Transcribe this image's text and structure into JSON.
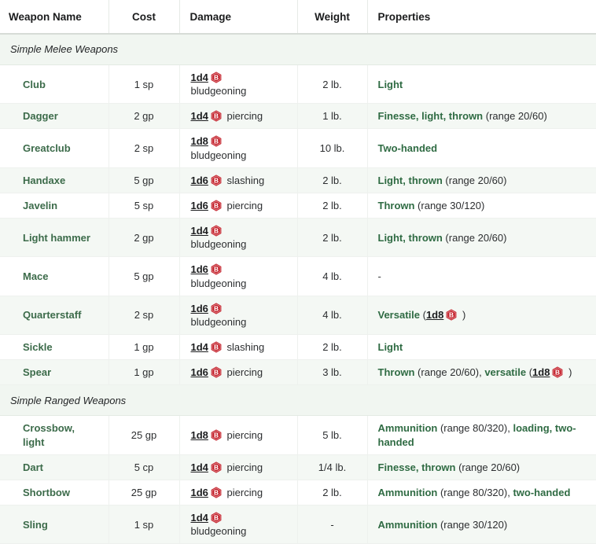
{
  "table": {
    "columns": [
      {
        "key": "name",
        "label": "Weapon Name"
      },
      {
        "key": "cost",
        "label": "Cost"
      },
      {
        "key": "damage",
        "label": "Damage"
      },
      {
        "key": "weight",
        "label": "Weight"
      },
      {
        "key": "props",
        "label": "Properties"
      }
    ],
    "icons": {
      "roll_badge": "beyond20-roll-badge-icon",
      "roll_badge_letter": "B",
      "roll_badge_color": "#c4202a"
    },
    "colors": {
      "weapon_link": "#3c6b4a",
      "property_link": "#2f6b43",
      "dice_link": "#1c1d1f",
      "row_alt_background": "#f4f8f4",
      "section_background": "#f1f6f1",
      "header_border": "#d7dcd7"
    },
    "sections": [
      {
        "title": "Simple Melee Weapons",
        "rows": [
          {
            "name": "Club",
            "cost": "1 sp",
            "damage_dice": "1d4",
            "damage_type": "bludgeoning",
            "damage_wrap": true,
            "weight": "2 lb.",
            "properties": [
              {
                "text": "Light",
                "link": true
              }
            ]
          },
          {
            "name": "Dagger",
            "cost": "2 gp",
            "damage_dice": "1d4",
            "damage_type": "piercing",
            "damage_wrap": false,
            "weight": "1 lb.",
            "properties": [
              {
                "text": "Finesse, light, thrown",
                "link": true
              },
              {
                "text": " (range 20/60)",
                "link": false
              }
            ]
          },
          {
            "name": "Greatclub",
            "cost": "2 sp",
            "damage_dice": "1d8",
            "damage_type": "bludgeoning",
            "damage_wrap": true,
            "weight": "10 lb.",
            "properties": [
              {
                "text": "Two-handed",
                "link": true
              }
            ]
          },
          {
            "name": "Handaxe",
            "cost": "5 gp",
            "damage_dice": "1d6",
            "damage_type": "slashing",
            "damage_wrap": false,
            "weight": "2 lb.",
            "properties": [
              {
                "text": "Light, thrown",
                "link": true
              },
              {
                "text": " (range 20/60)",
                "link": false
              }
            ]
          },
          {
            "name": "Javelin",
            "cost": "5 sp",
            "damage_dice": "1d6",
            "damage_type": "piercing",
            "damage_wrap": false,
            "weight": "2 lb.",
            "properties": [
              {
                "text": "Thrown",
                "link": true
              },
              {
                "text": " (range 30/120)",
                "link": false
              }
            ]
          },
          {
            "name": "Light hammer",
            "cost": "2 gp",
            "damage_dice": "1d4",
            "damage_type": "bludgeoning",
            "damage_wrap": true,
            "weight": "2 lb.",
            "properties": [
              {
                "text": "Light, thrown",
                "link": true
              },
              {
                "text": " (range 20/60)",
                "link": false
              }
            ]
          },
          {
            "name": "Mace",
            "cost": "5 gp",
            "damage_dice": "1d6",
            "damage_type": "bludgeoning",
            "damage_wrap": true,
            "weight": "4 lb.",
            "properties": [
              {
                "text": "-",
                "link": false
              }
            ]
          },
          {
            "name": "Quarterstaff",
            "cost": "2 sp",
            "damage_dice": "1d6",
            "damage_type": "bludgeoning",
            "damage_wrap": true,
            "weight": "4 lb.",
            "properties": [
              {
                "text": "Versatile",
                "link": true
              },
              {
                "text": " (",
                "link": false
              },
              {
                "text": "1d8",
                "dice": true
              },
              {
                "text": " )",
                "link": false
              }
            ]
          },
          {
            "name": "Sickle",
            "cost": "1 gp",
            "damage_dice": "1d4",
            "damage_type": "slashing",
            "damage_wrap": false,
            "weight": "2 lb.",
            "properties": [
              {
                "text": "Light",
                "link": true
              }
            ]
          },
          {
            "name": "Spear",
            "cost": "1 gp",
            "damage_dice": "1d6",
            "damage_type": "piercing",
            "damage_wrap": false,
            "weight": "3 lb.",
            "properties": [
              {
                "text": "Thrown",
                "link": true
              },
              {
                "text": " (range 20/60), ",
                "link": false
              },
              {
                "text": "versatile",
                "link": true
              },
              {
                "text": " (",
                "link": false
              },
              {
                "text": "1d8",
                "dice": true
              },
              {
                "text": " )",
                "link": false
              }
            ]
          }
        ]
      },
      {
        "title": "Simple Ranged Weapons",
        "rows": [
          {
            "name": "Crossbow,\nlight",
            "cost": "25 gp",
            "damage_dice": "1d8",
            "damage_type": "piercing",
            "damage_wrap": false,
            "weight": "5 lb.",
            "properties": [
              {
                "text": "Ammunition",
                "link": true
              },
              {
                "text": " (range 80/320), ",
                "link": false
              },
              {
                "text": "loading, two-handed",
                "link": true
              }
            ]
          },
          {
            "name": "Dart",
            "cost": "5 cp",
            "damage_dice": "1d4",
            "damage_type": "piercing",
            "damage_wrap": false,
            "weight": "1/4 lb.",
            "properties": [
              {
                "text": "Finesse, thrown",
                "link": true
              },
              {
                "text": " (range 20/60)",
                "link": false
              }
            ]
          },
          {
            "name": "Shortbow",
            "cost": "25 gp",
            "damage_dice": "1d6",
            "damage_type": "piercing",
            "damage_wrap": false,
            "weight": "2 lb.",
            "properties": [
              {
                "text": "Ammunition",
                "link": true
              },
              {
                "text": " (range 80/320), ",
                "link": false
              },
              {
                "text": "two-handed",
                "link": true
              }
            ]
          },
          {
            "name": "Sling",
            "cost": "1 sp",
            "damage_dice": "1d4",
            "damage_type": "bludgeoning",
            "damage_wrap": true,
            "weight": "-",
            "properties": [
              {
                "text": "Ammunition",
                "link": true
              },
              {
                "text": " (range 30/120)",
                "link": false
              }
            ]
          }
        ]
      }
    ]
  }
}
